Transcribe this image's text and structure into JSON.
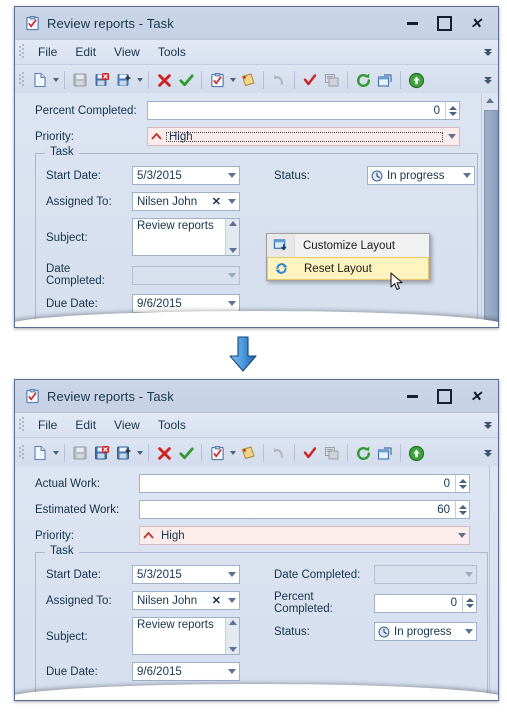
{
  "window1": {
    "title": "Review reports - Task",
    "title_icon": "task-clipboard-icon",
    "buttons": {
      "minimize": "minimize-icon",
      "maximize": "maximize-icon",
      "close": "close-icon"
    },
    "menu": {
      "items": [
        "File",
        "Edit",
        "View",
        "Tools"
      ],
      "overflow": "menu-overflow-chevron"
    },
    "toolbar": {
      "items": [
        "new-document-icon",
        "save-icon",
        "save-and-close-icon",
        "save-and-new-icon",
        "delete-icon",
        "mark-complete-icon",
        "task-icon",
        "notes-icon",
        "undo-icon",
        "check-icon",
        "details-icon",
        "recurrence-icon",
        "open-window-icon",
        "move-up-icon"
      ]
    },
    "fields": [
      {
        "label": "Percent Completed:",
        "value": "0",
        "type": "spin"
      },
      {
        "label": "Priority:",
        "value": "High",
        "type": "combo-priority",
        "icon": "priority-high-arrow-icon"
      }
    ],
    "group": {
      "title": "Task",
      "left": [
        {
          "label": "Start Date:",
          "value": "5/3/2015",
          "type": "date"
        },
        {
          "label": "Assigned To:",
          "value": "Nilsen John",
          "type": "lookup"
        },
        {
          "label": "Subject:",
          "value": "Review reports",
          "type": "memo"
        },
        {
          "label": "Date Completed:",
          "value": "",
          "type": "date-readonly"
        },
        {
          "label": "Due Date:",
          "value": "9/6/2015",
          "type": "date"
        }
      ],
      "right": [
        {
          "label": "Status:",
          "value": "In progress",
          "type": "combo-status",
          "icon": "status-clock-icon"
        }
      ]
    },
    "scrollbar": "vertical-scrollbar"
  },
  "context_menu": {
    "items": [
      {
        "label": "Customize Layout",
        "icon": "customize-layout-icon",
        "selected": false
      },
      {
        "label": "Reset Layout",
        "icon": "reset-layout-icon",
        "selected": true
      }
    ]
  },
  "flow_arrow": {
    "name": "down-arrow",
    "color": "#3c8fe0"
  },
  "window2": {
    "title": "Review reports - Task",
    "title_icon": "task-clipboard-icon",
    "buttons": {
      "minimize": "minimize-icon",
      "maximize": "maximize-icon",
      "close": "close-icon"
    },
    "menu": {
      "items": [
        "File",
        "Edit",
        "View",
        "Tools"
      ],
      "overflow": "menu-overflow-chevron"
    },
    "fields": [
      {
        "label": "Actual Work:",
        "value": "0",
        "type": "spin"
      },
      {
        "label": "Estimated Work:",
        "value": "60",
        "type": "spin"
      },
      {
        "label": "Priority:",
        "value": "High",
        "type": "combo-priority",
        "icon": "priority-high-arrow-icon"
      }
    ],
    "group": {
      "title": "Task",
      "left": [
        {
          "label": "Start Date:",
          "value": "5/3/2015",
          "type": "date"
        },
        {
          "label": "Assigned To:",
          "value": "Nilsen John",
          "type": "lookup"
        },
        {
          "label": "Subject:",
          "value": "Review reports",
          "type": "memo"
        },
        {
          "label": "Due Date:",
          "value": "9/6/2015",
          "type": "date"
        }
      ],
      "right": [
        {
          "label": "Date Completed:",
          "value": "",
          "type": "date-readonly"
        },
        {
          "label": "Percent Completed:",
          "value": "0",
          "type": "spin"
        },
        {
          "label": "Status:",
          "value": "In progress",
          "type": "combo-status",
          "icon": "status-clock-icon"
        }
      ]
    }
  },
  "colors": {
    "priority_field_bg": "#fcecec",
    "accent_blue": "#3c8fe0",
    "menu_highlight": "#fdf4bf"
  }
}
